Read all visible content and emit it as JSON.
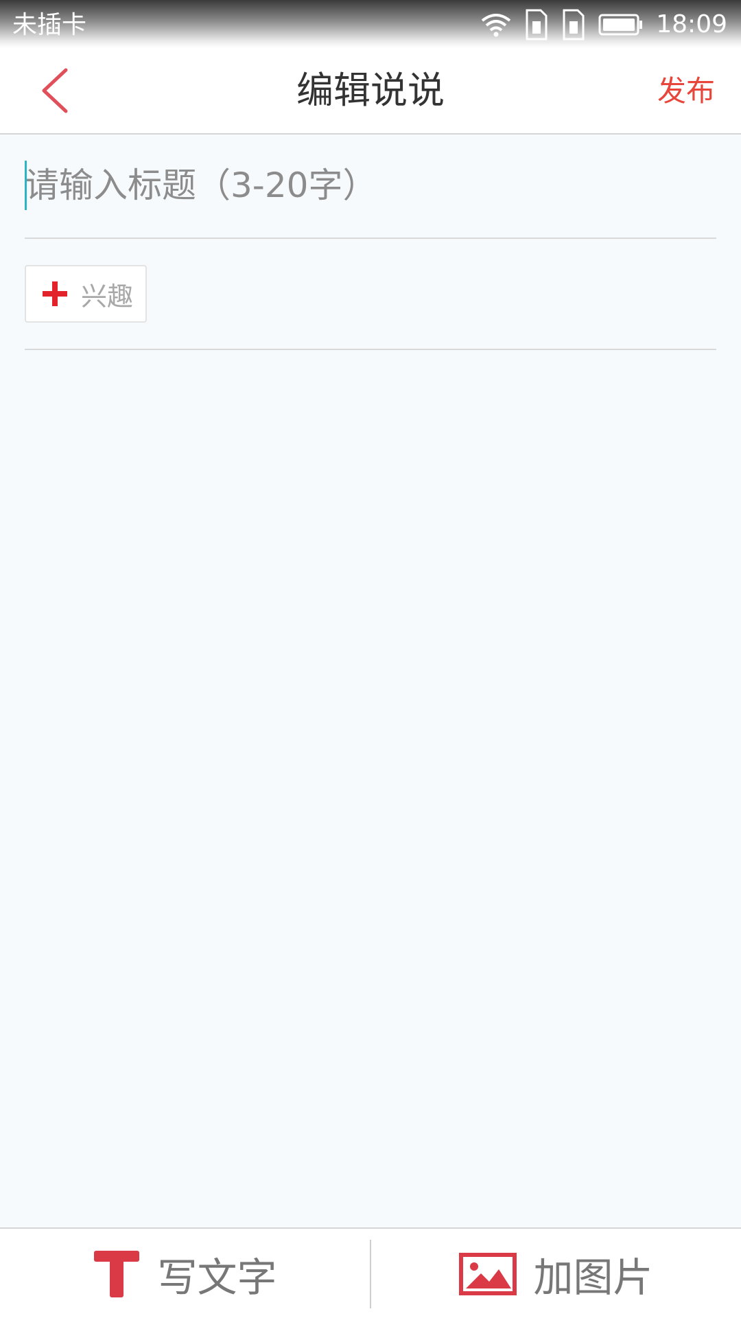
{
  "status_bar": {
    "carrier": "未插卡",
    "time": "18:09",
    "icons": [
      "wifi-icon",
      "sim1-icon",
      "sim2-icon",
      "battery-icon"
    ]
  },
  "header": {
    "back_icon": "chevron-left-icon",
    "title": "编辑说说",
    "publish_label": "发布"
  },
  "form": {
    "title_placeholder": "请输入标题（3-20字）",
    "title_value": "",
    "interest_label": "兴趣",
    "interest_icon": "plus-icon"
  },
  "toolbar": {
    "write_text_label": "写文字",
    "write_text_icon": "text-t-icon",
    "add_image_label": "加图片",
    "add_image_icon": "image-icon"
  },
  "colors": {
    "accent": "#e8463b",
    "icon_red": "#d93a45",
    "cursor": "#2bb5c4",
    "background": "#f7fafd"
  }
}
